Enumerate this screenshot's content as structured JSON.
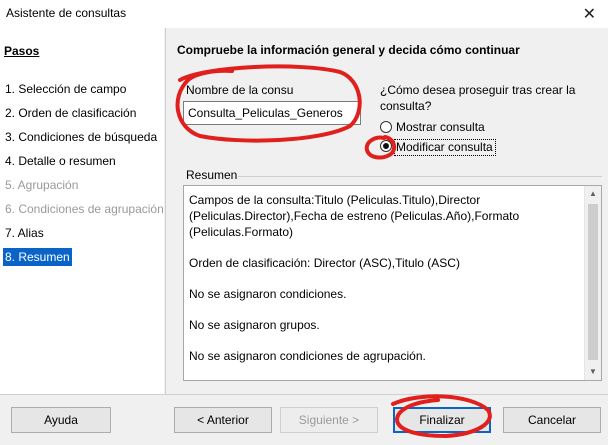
{
  "window": {
    "title": "Asistente de consultas",
    "close_glyph": "✕"
  },
  "sidebar": {
    "heading": "Pasos",
    "steps": [
      {
        "label": "1. Selección de campo",
        "state": "normal"
      },
      {
        "label": "2. Orden de clasificación",
        "state": "normal"
      },
      {
        "label": "3. Condiciones de búsqueda",
        "state": "normal"
      },
      {
        "label": "4. Detalle o resumen",
        "state": "normal"
      },
      {
        "label": "5. Agrupación",
        "state": "disabled"
      },
      {
        "label": "6. Condiciones de agrupación",
        "state": "disabled"
      },
      {
        "label": "7. Alias",
        "state": "normal"
      },
      {
        "label": "8. Resumen",
        "state": "active"
      }
    ]
  },
  "main": {
    "title": "Compruebe la información general y decida cómo continuar",
    "name_label": "Nombre de la consu",
    "name_value": "Consulta_Peliculas_Generos",
    "proceed_question_line1": "¿Cómo desea proseguir tras crear la",
    "proceed_question_line2": "consulta?",
    "options": [
      {
        "label": "Mostrar consulta",
        "selected": false
      },
      {
        "label": "Modificar consulta",
        "selected": true
      }
    ],
    "summary_label": "Resumen",
    "summary_lines": [
      "Campos de la consulta:Titulo (Peliculas.Titulo),Director (Peliculas.Director),Fecha de estreno (Peliculas.Año),Formato (Peliculas.Formato)",
      "Orden de clasificación: Director (ASC),Titulo (ASC)",
      "No se asignaron condiciones.",
      "No se asignaron grupos.",
      "No se asignaron condiciones de agrupación."
    ]
  },
  "buttons": {
    "help": "Ayuda",
    "previous": "< Anterior",
    "next": "Siguiente >",
    "finish": "Finalizar",
    "cancel": "Cancelar"
  },
  "colors": {
    "annotation": "#e0201c",
    "selection": "#0a64c8"
  },
  "icons": {
    "radio": "radio-button-icon",
    "arrow_up": "scroll-up-arrow-icon",
    "arrow_down": "scroll-down-arrow-icon"
  }
}
